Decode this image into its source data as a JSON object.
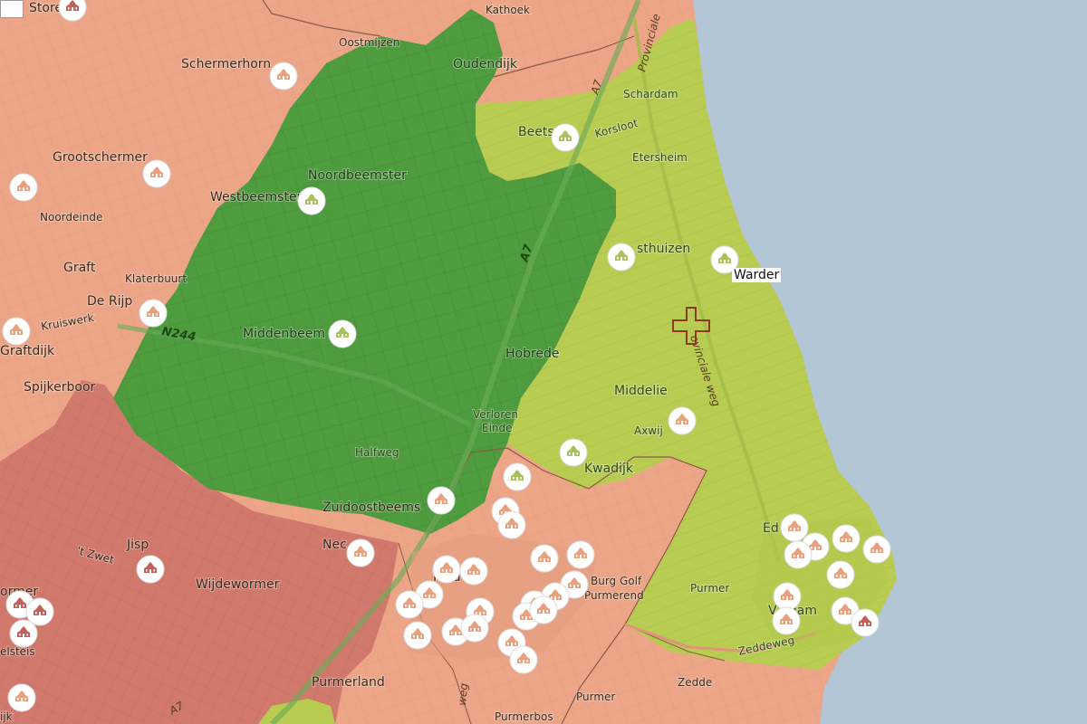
{
  "colors": {
    "water": "#b2c6d6",
    "orange_region": "#eca587",
    "red_region": "#d0796c",
    "dark_green_region": "#4f9c3f",
    "light_green_region": "#b8cc52",
    "marker_fill": "#ffffff",
    "marker_icon_orange": "#e8a07f",
    "marker_icon_green": "#a9c05c",
    "marker_icon_red": "#c45f5a",
    "cross_marker": "#8b3a1e"
  },
  "places": {
    "storen": "Storen",
    "kathoek": "Kathoek",
    "oostmijzen": "Oostmijzen",
    "schermerhorn": "Schermerhorn",
    "oudendijk": "Oudendijk",
    "schardam": "Schardam",
    "grootschermer": "Grootschermer",
    "beets": "Beets",
    "korsloot": "Korsloot",
    "etersheim": "Etersheim",
    "noordbeemster": "Noordbeemster",
    "westbeemster": "Westbeemster",
    "noordeinde": "Noordeinde",
    "graft": "Graft",
    "klaterbuurt": "Klaterbuurt",
    "de_rijp": "De Rijp",
    "kruiswerk": "Kruiswerk",
    "oosthuizen": "sthuizen",
    "warder": "Warder",
    "graftdijk": "Graftdijk",
    "middenbeemster": "Middenbeem",
    "hobrede": "Hobrede",
    "spijkerboor": "Spijkerboor",
    "middelie": "Middelie",
    "verloren_einde_1": "Verloren",
    "verloren_einde_2": "Einde",
    "axwijk": "Axwij",
    "halfweg": "Halfweg",
    "kwadijk": "Kwadijk",
    "zuidoostbeemster": "Zuidoostbeems",
    "edam": "Ed",
    "jisp": "Jisp",
    "zwet": "'t Zwet",
    "neck": "Nec",
    "wijdewormer": "Wijdewormer",
    "purmerend": "P        nd",
    "burg_golf_1": "Burg Golf",
    "burg_golf_2": "Purmerend",
    "wormer": "ormer",
    "purmer": "Purmer",
    "volendam": "V    ndam",
    "zeddeweg": "Zeddeweg",
    "zedde": "Zedde",
    "purmerland": "Purmerland",
    "purmer_south": "Purmer",
    "purmerbos": "Purmerbos",
    "polsteis": "elsteis",
    "ijk": "ijk"
  },
  "roads": {
    "a7_north": "A7",
    "a7_mid": "A7",
    "a7_south": "A7",
    "n244": "N244",
    "provinciale_north": "Provinciale",
    "provinciale_weg": "ovinciale weg",
    "dijkweg": "weg"
  }
}
